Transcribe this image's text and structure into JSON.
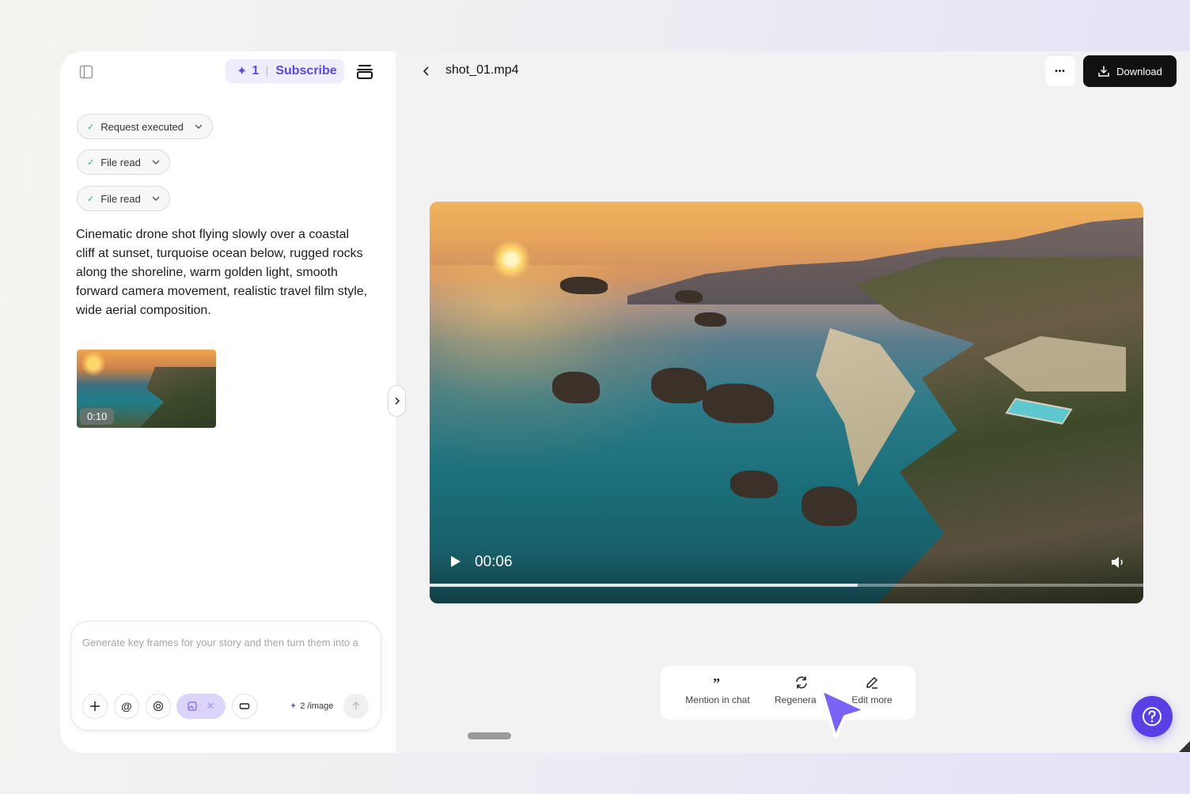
{
  "header": {
    "credits": "1",
    "subscribe_label": "Subscribe",
    "file_name": "shot_01.mp4",
    "more_label": "•••",
    "download_label": "Download"
  },
  "tool_calls": [
    {
      "label": "Request executed"
    },
    {
      "label": "File read"
    },
    {
      "label": "File read"
    }
  ],
  "prompt": "Cinematic drone shot flying slowly over a coastal cliff at sunset, turquoise ocean below, rugged rocks along the shoreline, warm golden light, smooth forward camera movement, realistic travel film style, wide aerial composition.",
  "thumbnail": {
    "duration": "0:10"
  },
  "chat": {
    "placeholder": "Generate key frames for your story and then turn them into a",
    "cost_label": "2 /image"
  },
  "player": {
    "time": "00:06",
    "progress": 0.6
  },
  "actions": {
    "mention": "Mention in chat",
    "regenerate": "Regenera",
    "edit": "Edit more"
  },
  "colors": {
    "accent": "#5b49e6",
    "help": "#5840e6",
    "check": "#22b573"
  }
}
